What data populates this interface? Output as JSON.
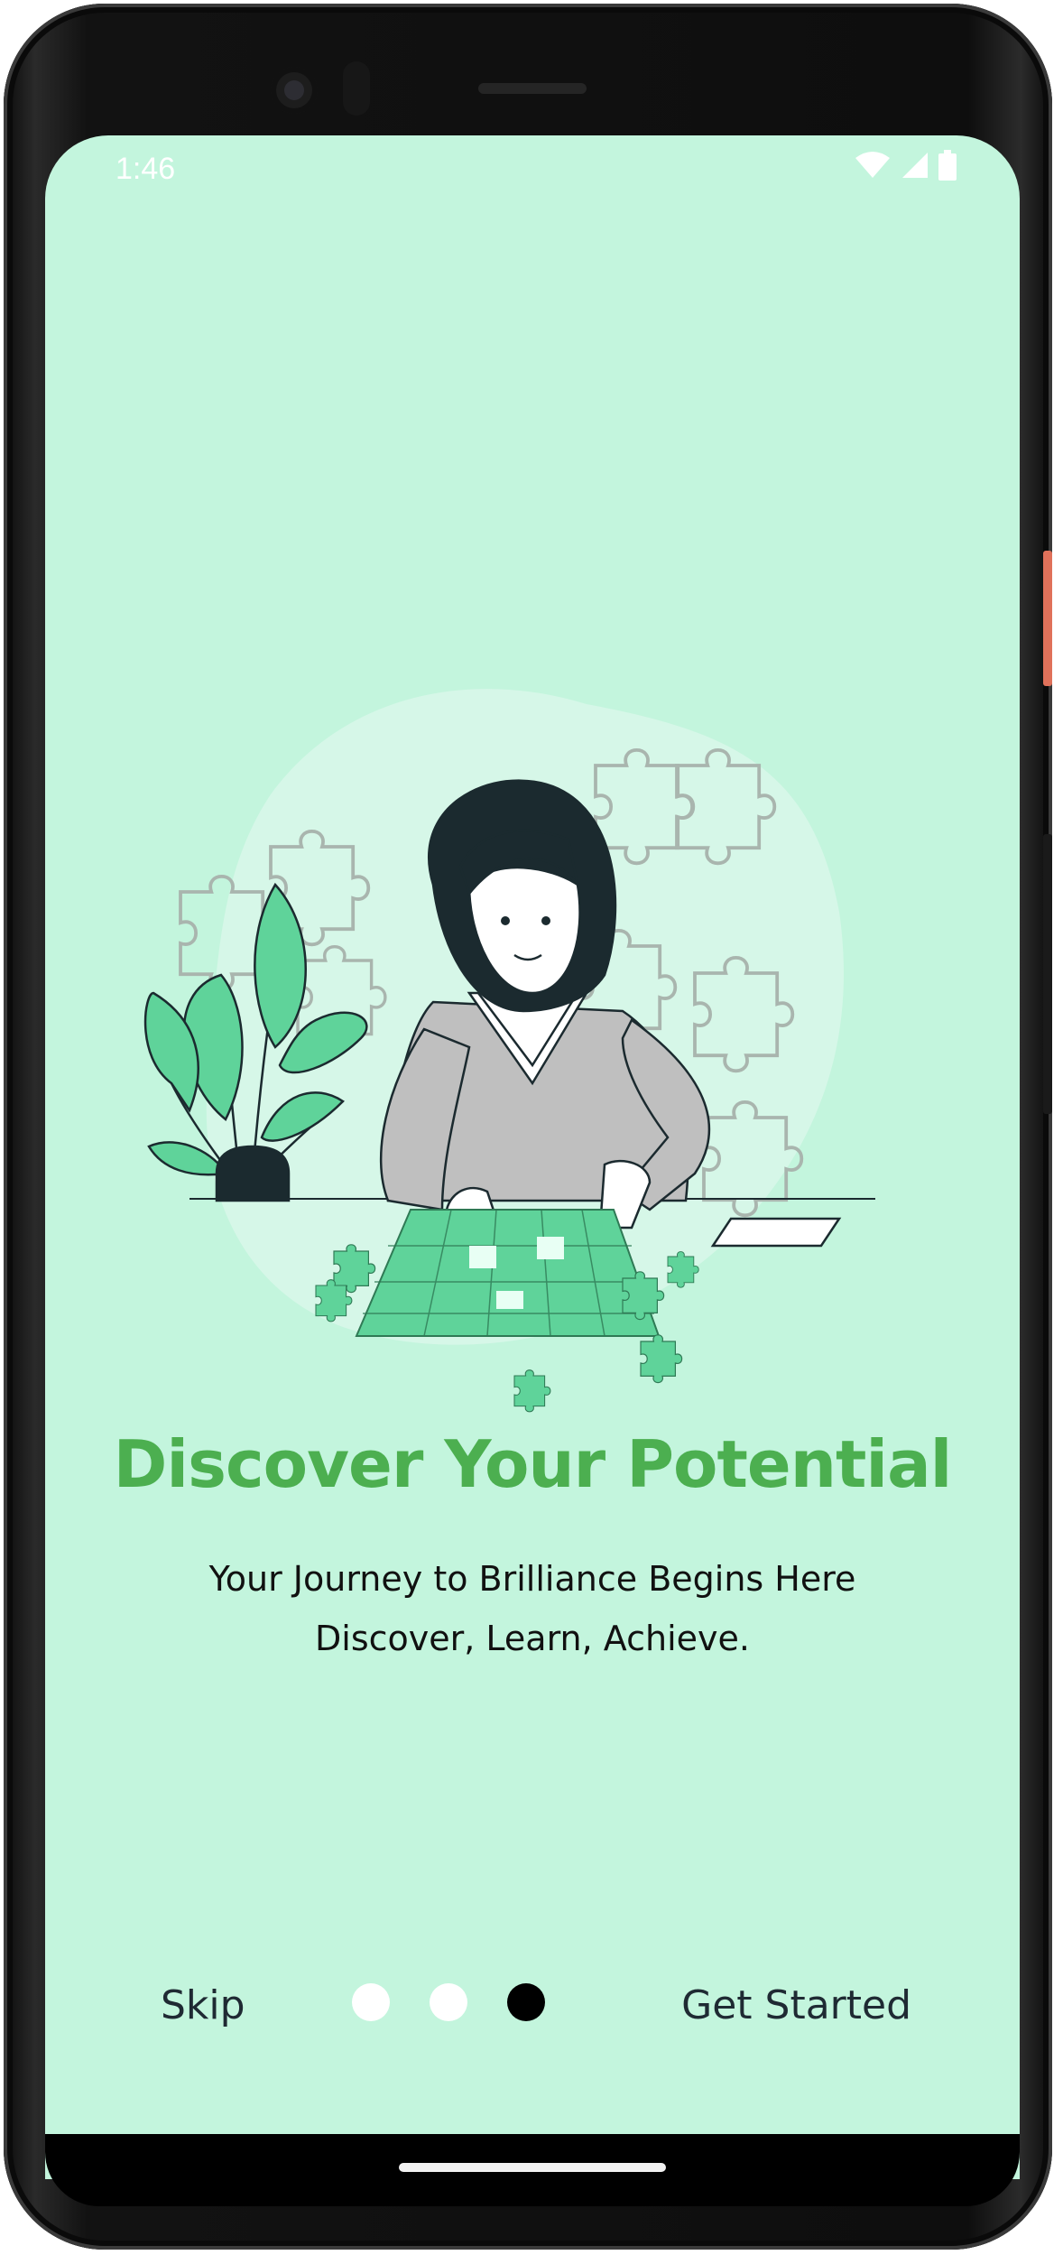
{
  "status_bar": {
    "time": "1:46",
    "icons": [
      "wifi-icon",
      "cellular-signal-icon",
      "battery-icon"
    ]
  },
  "onboarding": {
    "title": "Discover Your Potential",
    "subtitle_lines": [
      "Your Journey to Brilliance Begins Here",
      "Discover, Learn, Achieve."
    ],
    "illustration": "woman-solving-jigsaw-puzzle-illustration",
    "page_indicator": {
      "total": 3,
      "current": 3
    }
  },
  "navigation": {
    "skip_label": "Skip",
    "get_started_label": "Get Started"
  },
  "colors": {
    "background": "#c3f5dd",
    "title": "#4caf50",
    "puzzle_green": "#5fd39a",
    "dot_inactive": "#ffffff",
    "dot_active": "#000000"
  }
}
